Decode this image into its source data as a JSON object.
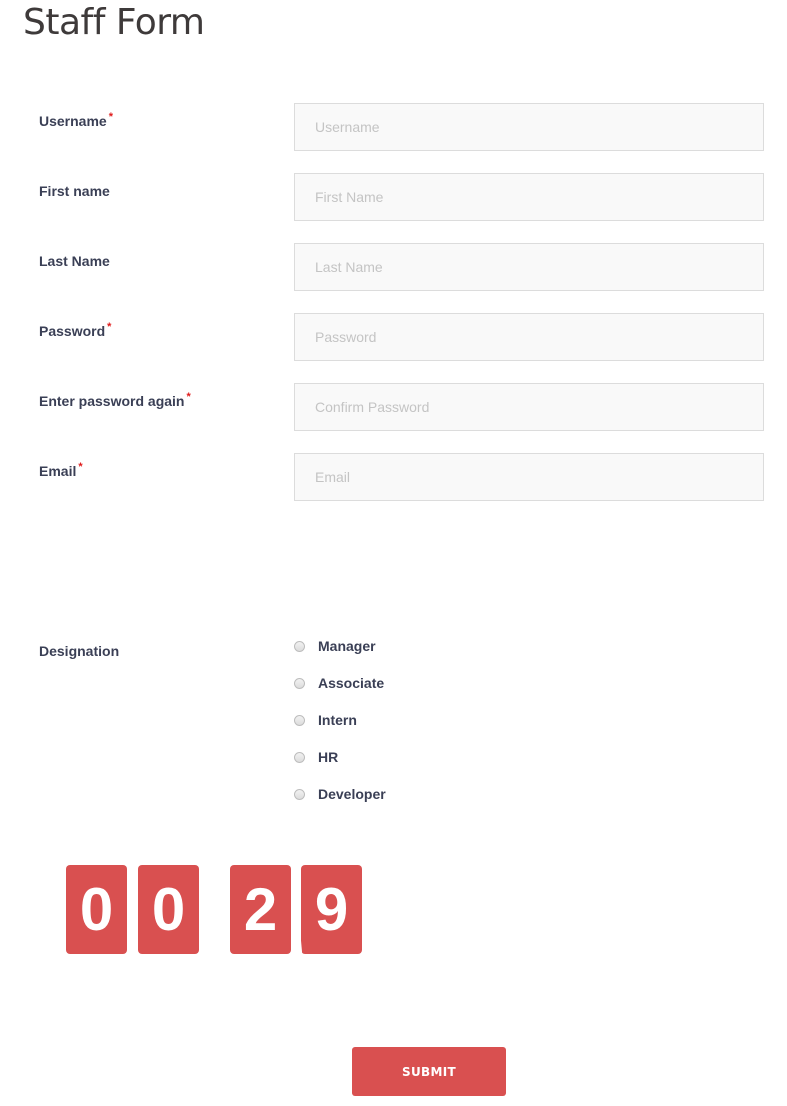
{
  "page": {
    "title": "Staff Form"
  },
  "form": {
    "fields": [
      {
        "label": "Username",
        "required": "*",
        "placeholder": "Username",
        "value": ""
      },
      {
        "label": "First name",
        "required": "",
        "placeholder": "First Name",
        "value": ""
      },
      {
        "label": "Last Name",
        "required": "",
        "placeholder": "Last Name",
        "value": ""
      },
      {
        "label": "Password",
        "required": "*",
        "placeholder": "Password",
        "value": ""
      },
      {
        "label": "Enter password again",
        "required": "*",
        "placeholder": "Confirm Password",
        "value": ""
      },
      {
        "label": "Email",
        "required": "*",
        "placeholder": "Email",
        "value": ""
      }
    ],
    "designation": {
      "label": "Designation",
      "options": [
        "Manager",
        "Associate",
        "Intern",
        "HR",
        "Developer"
      ],
      "selected": null
    },
    "timer": {
      "digits": [
        "0",
        "0",
        "2",
        "9"
      ],
      "display": "00:29"
    },
    "submit_label": "SUBMIT"
  },
  "colors": {
    "accent": "#d95050",
    "required": "#e01b1b",
    "label": "#3a3f55"
  }
}
